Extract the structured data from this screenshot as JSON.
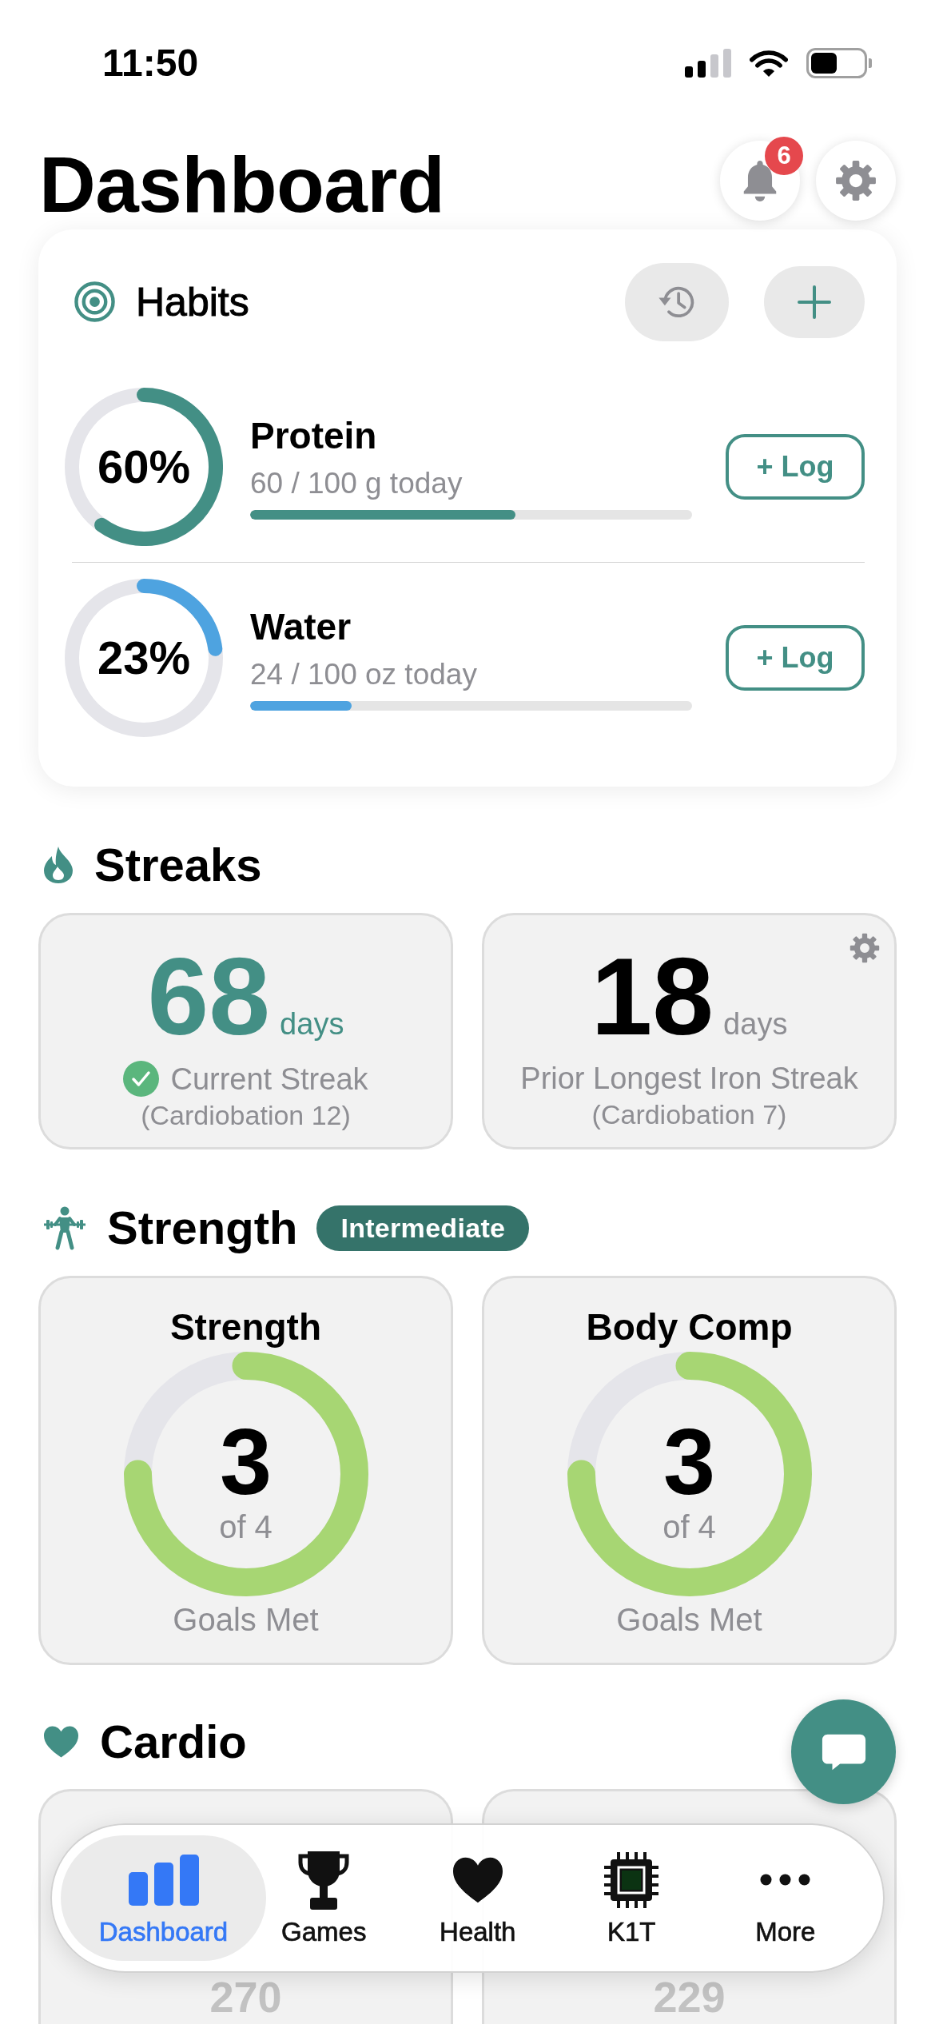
{
  "status_bar": {
    "time": "11:50"
  },
  "header": {
    "title": "Dashboard",
    "notification_count": "6"
  },
  "habits": {
    "title": "Habits",
    "items": [
      {
        "name": "Protein",
        "percent": "60%",
        "progress_text": "60 / 100 g today",
        "level": 0.6,
        "color": "#438f85",
        "log_button": "+ Log"
      },
      {
        "name": "Water",
        "percent": "23%",
        "progress_text": "24 / 100 oz today",
        "level": 0.23,
        "color": "#4ea3e0",
        "log_button": "+ Log"
      }
    ]
  },
  "streaks": {
    "title": "Streaks",
    "cards": [
      {
        "kind": "current",
        "value": "68",
        "unit": "days",
        "label": "Current Streak",
        "detail": "(Cardiobation 12)"
      },
      {
        "kind": "record",
        "value": "18",
        "unit": "days",
        "label": "Prior Longest Iron Streak",
        "detail": "(Cardiobation 7)"
      }
    ]
  },
  "strength": {
    "title": "Strength",
    "badge": "Intermediate",
    "cards": [
      {
        "title": "Strength",
        "value": "3",
        "total": "of 4",
        "caption": "Goals Met"
      },
      {
        "title": "Body Comp",
        "value": "3",
        "total": "of 4",
        "caption": "Goals Met"
      }
    ]
  },
  "cardio": {
    "title": "Cardio",
    "cards": [
      {
        "value": "270"
      },
      {
        "value": "229"
      }
    ]
  },
  "tab_bar": {
    "tabs": [
      {
        "label": "Dashboard",
        "selected": true
      },
      {
        "label": "Games",
        "selected": false
      },
      {
        "label": "Health",
        "selected": false
      },
      {
        "label": "K1T",
        "selected": false
      },
      {
        "label": "More",
        "selected": false
      }
    ]
  }
}
